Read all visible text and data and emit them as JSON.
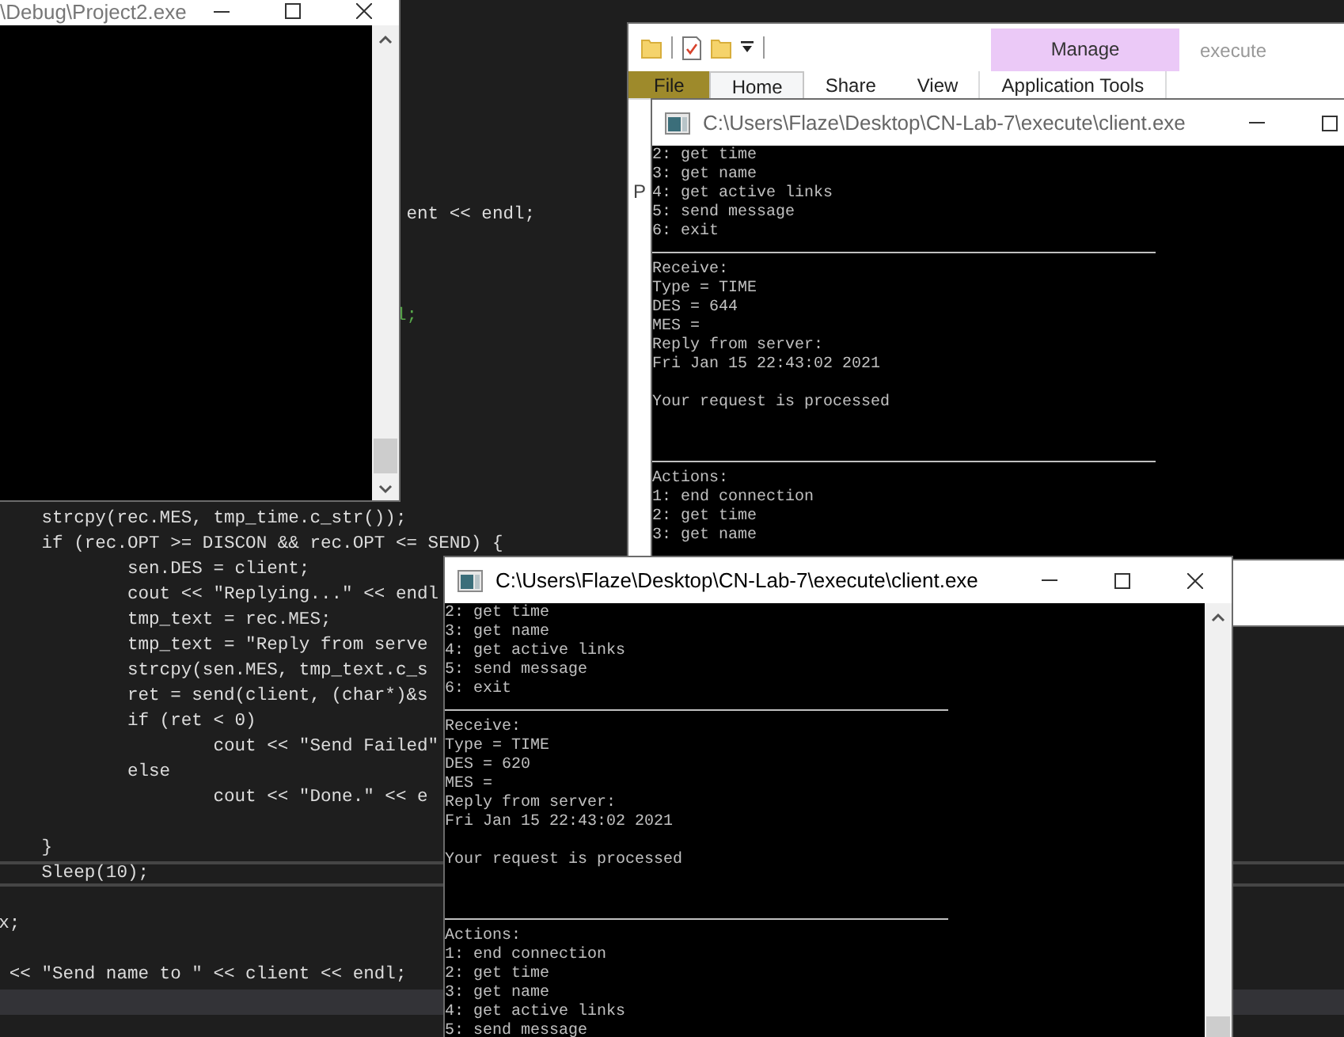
{
  "editor": {
    "lines": [
      {
        "text": "\t\t\t\t\t  ent << endl;",
        "kind": "code",
        "current": false
      },
      {
        "text": "\t\t\t\t\t l;",
        "kind": "comment",
        "current": false
      },
      {
        "text": "\tstrcpy(rec.MES, tmp_time.c_str());",
        "kind": "code",
        "current": false
      },
      {
        "text": "\tif (rec.OPT >= DISCON && rec.OPT <= SEND) {",
        "kind": "code",
        "current": false
      },
      {
        "text": "\t\tsen.DES = client;",
        "kind": "code",
        "current": false
      },
      {
        "text": "\t\tcout << \"Replying...\" << endl",
        "kind": "code",
        "current": false
      },
      {
        "text": "\t\ttmp_text = rec.MES;",
        "kind": "code",
        "current": false
      },
      {
        "text": "\t\ttmp_text = \"Reply from serve",
        "kind": "code",
        "current": false
      },
      {
        "text": "\t\tstrcpy(sen.MES, tmp_text.c_s",
        "kind": "code",
        "current": false
      },
      {
        "text": "\t\tret = send(client, (char*)&s",
        "kind": "code",
        "current": false
      },
      {
        "text": "\t\tif (ret < 0)",
        "kind": "code",
        "current": false
      },
      {
        "text": "\t\t\tcout << \"Send Failed\"",
        "kind": "code",
        "current": false
      },
      {
        "text": "\t\telse",
        "kind": "code",
        "current": false
      },
      {
        "text": "\t\t\tcout << \"Done.\" << e",
        "kind": "code",
        "current": false
      },
      {
        "text": "\t}",
        "kind": "code",
        "current": false
      },
      {
        "text": "\tSleep(10);",
        "kind": "code",
        "current": true
      },
      {
        "text": "    x;",
        "kind": "code",
        "current": false
      },
      {
        "text": "     << \"Send name to \" << client << endl;",
        "kind": "code",
        "current": false
      }
    ]
  },
  "console_window": {
    "title": "\\Debug\\Project2.exe"
  },
  "explorer": {
    "title": "execute",
    "context_header": "Manage",
    "body_text": "P",
    "tabs": [
      {
        "label": "File",
        "kind": "file",
        "selected": false
      },
      {
        "label": "Home",
        "kind": "tab",
        "selected": true
      },
      {
        "label": "Share",
        "kind": "tab",
        "selected": false
      },
      {
        "label": "View",
        "kind": "tab",
        "selected": false
      },
      {
        "label": "Application Tools",
        "kind": "context",
        "selected": false
      }
    ]
  },
  "client_windows": [
    {
      "title": "C:\\Users\\Flaze\\Desktop\\CN-Lab-7\\execute\\client.exe",
      "active": false,
      "lines": [
        {
          "kind": "text",
          "text": "2: get time"
        },
        {
          "kind": "text",
          "text": "3: get name"
        },
        {
          "kind": "text",
          "text": "4: get active links"
        },
        {
          "kind": "text",
          "text": "5: send message"
        },
        {
          "kind": "text",
          "text": "6: exit"
        },
        {
          "kind": "rule"
        },
        {
          "kind": "text",
          "text": "Receive:"
        },
        {
          "kind": "text",
          "text": "Type = TIME"
        },
        {
          "kind": "text",
          "text": "DES = 644"
        },
        {
          "kind": "text",
          "text": "MES ="
        },
        {
          "kind": "text",
          "text": "Reply from server:"
        },
        {
          "kind": "text",
          "text": "Fri Jan 15 22:43:02 2021"
        },
        {
          "kind": "blank"
        },
        {
          "kind": "text",
          "text": "Your request is processed"
        },
        {
          "kind": "blank"
        },
        {
          "kind": "blank"
        },
        {
          "kind": "rule"
        },
        {
          "kind": "text",
          "text": "Actions:"
        },
        {
          "kind": "text",
          "text": "1: end connection"
        },
        {
          "kind": "text",
          "text": "2: get time"
        },
        {
          "kind": "text",
          "text": "3: get name"
        }
      ]
    },
    {
      "title": "C:\\Users\\Flaze\\Desktop\\CN-Lab-7\\execute\\client.exe",
      "active": true,
      "lines": [
        {
          "kind": "text",
          "text": "2: get time"
        },
        {
          "kind": "text",
          "text": "3: get name"
        },
        {
          "kind": "text",
          "text": "4: get active links"
        },
        {
          "kind": "text",
          "text": "5: send message"
        },
        {
          "kind": "text",
          "text": "6: exit"
        },
        {
          "kind": "rule"
        },
        {
          "kind": "text",
          "text": "Receive:"
        },
        {
          "kind": "text",
          "text": "Type = TIME"
        },
        {
          "kind": "text",
          "text": "DES = 620"
        },
        {
          "kind": "text",
          "text": "MES ="
        },
        {
          "kind": "text",
          "text": "Reply from server:"
        },
        {
          "kind": "text",
          "text": "Fri Jan 15 22:43:02 2021"
        },
        {
          "kind": "blank"
        },
        {
          "kind": "text",
          "text": "Your request is processed"
        },
        {
          "kind": "blank"
        },
        {
          "kind": "blank"
        },
        {
          "kind": "rule"
        },
        {
          "kind": "text",
          "text": "Actions:"
        },
        {
          "kind": "text",
          "text": "1: end connection"
        },
        {
          "kind": "text",
          "text": "2: get time"
        },
        {
          "kind": "text",
          "text": "3: get name"
        },
        {
          "kind": "text",
          "text": "4: get active links"
        },
        {
          "kind": "text",
          "text": "5: send message"
        }
      ]
    }
  ]
}
